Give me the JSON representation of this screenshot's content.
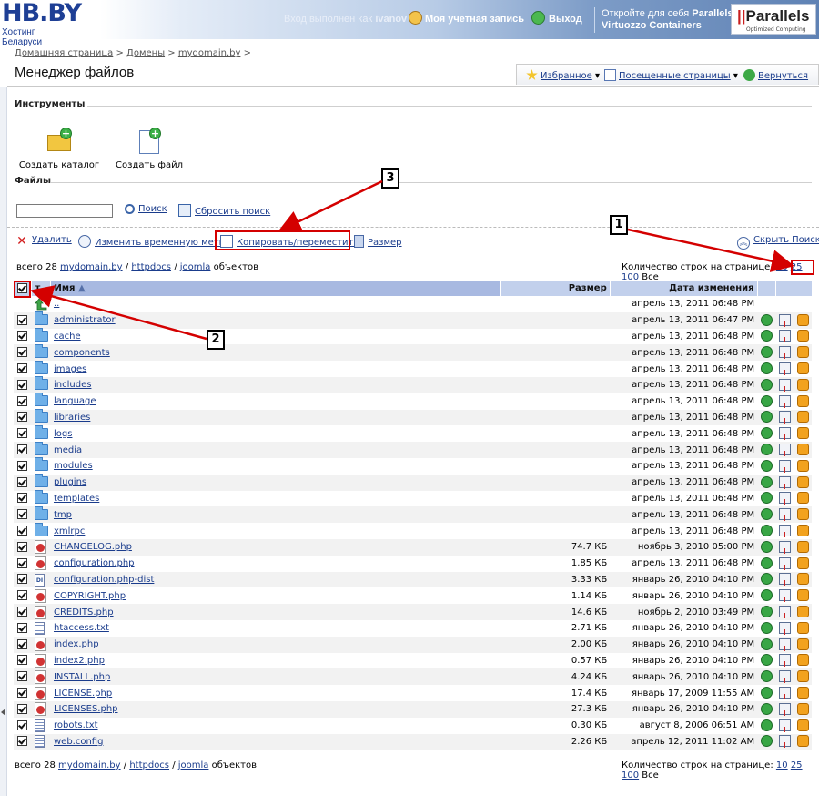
{
  "header": {
    "logo": "HB.BY",
    "logo_sub": "Хостинг Беларуси",
    "logged_in_as": "Вход выполнен как",
    "user": "ivanov",
    "account": "Моя учетная запись",
    "logout": "Выход",
    "promo_line1": "Откройте для себя",
    "promo_brand": "Parallels",
    "promo_line2": "Virtuozzo Containers",
    "parallels_logo": "Parallels",
    "parallels_sub": "Optimized Computing"
  },
  "breadcrumb": {
    "home": "Домашняя страница",
    "domains": "Домены",
    "domain": "mydomain.by"
  },
  "page": {
    "title": "Менеджер файлов"
  },
  "topnav": {
    "favorites": "Избранное",
    "visited": "Посещенные страницы",
    "back": "Вернуться"
  },
  "tools": {
    "section": "Инструменты",
    "create_dir": "Создать каталог",
    "create_file": "Создать файл"
  },
  "files": {
    "section": "Файлы",
    "search_value": "",
    "search": "Поиск",
    "reset_search": "Сбросить поиск",
    "delete": "Удалить",
    "timestamp": "Изменить временную метку",
    "copy_move": "Копировать/переместить",
    "size": "Размер",
    "hide_search": "Скрыть Поиск"
  },
  "summary": {
    "total_prefix": "всего 28",
    "path1": "mydomain.by",
    "path2": "httpdocs",
    "path3": "joomla",
    "total_suffix": "объектов",
    "rows_label": "Количество строк на странице:",
    "r10": "10",
    "r25": "25",
    "r100": "100",
    "rall": "Все"
  },
  "table": {
    "col_t": "т",
    "col_name": "Имя",
    "col_size": "Размер",
    "col_date": "Дата изменения"
  },
  "annotations": {
    "b1": "1",
    "b2": "2",
    "b3": "3"
  },
  "rows": [
    {
      "type": "up",
      "name": "..",
      "size": "",
      "date": "апрель 13, 2011 06:48 PM"
    },
    {
      "type": "dir",
      "name": "administrator",
      "size": "",
      "date": "апрель 13, 2011 06:47 PM"
    },
    {
      "type": "dir",
      "name": "cache",
      "size": "",
      "date": "апрель 13, 2011 06:48 PM"
    },
    {
      "type": "dir",
      "name": "components",
      "size": "",
      "date": "апрель 13, 2011 06:48 PM"
    },
    {
      "type": "dir",
      "name": "images",
      "size": "",
      "date": "апрель 13, 2011 06:48 PM"
    },
    {
      "type": "dir",
      "name": "includes",
      "size": "",
      "date": "апрель 13, 2011 06:48 PM"
    },
    {
      "type": "dir",
      "name": "language",
      "size": "",
      "date": "апрель 13, 2011 06:48 PM"
    },
    {
      "type": "dir",
      "name": "libraries",
      "size": "",
      "date": "апрель 13, 2011 06:48 PM"
    },
    {
      "type": "dir",
      "name": "logs",
      "size": "",
      "date": "апрель 13, 2011 06:48 PM"
    },
    {
      "type": "dir",
      "name": "media",
      "size": "",
      "date": "апрель 13, 2011 06:48 PM"
    },
    {
      "type": "dir",
      "name": "modules",
      "size": "",
      "date": "апрель 13, 2011 06:48 PM"
    },
    {
      "type": "dir",
      "name": "plugins",
      "size": "",
      "date": "апрель 13, 2011 06:48 PM"
    },
    {
      "type": "dir",
      "name": "templates",
      "size": "",
      "date": "апрель 13, 2011 06:48 PM"
    },
    {
      "type": "dir",
      "name": "tmp",
      "size": "",
      "date": "апрель 13, 2011 06:48 PM"
    },
    {
      "type": "dir",
      "name": "xmlrpc",
      "size": "",
      "date": "апрель 13, 2011 06:48 PM"
    },
    {
      "type": "php",
      "name": "CHANGELOG.php",
      "size": "74.7 КБ",
      "date": "ноябрь 3, 2010 05:00 PM"
    },
    {
      "type": "php",
      "name": "configuration.php",
      "size": "1.85 КБ",
      "date": "апрель 13, 2011 06:48 PM"
    },
    {
      "type": "dist",
      "name": "configuration.php-dist",
      "size": "3.33 КБ",
      "date": "январь 26, 2010 04:10 PM"
    },
    {
      "type": "php",
      "name": "COPYRIGHT.php",
      "size": "1.14 КБ",
      "date": "январь 26, 2010 04:10 PM"
    },
    {
      "type": "php",
      "name": "CREDITS.php",
      "size": "14.6 КБ",
      "date": "ноябрь 2, 2010 03:49 PM"
    },
    {
      "type": "txt",
      "name": "htaccess.txt",
      "size": "2.71 КБ",
      "date": "январь 26, 2010 04:10 PM"
    },
    {
      "type": "php",
      "name": "index.php",
      "size": "2.00 КБ",
      "date": "январь 26, 2010 04:10 PM"
    },
    {
      "type": "php",
      "name": "index2.php",
      "size": "0.57 КБ",
      "date": "январь 26, 2010 04:10 PM"
    },
    {
      "type": "php",
      "name": "INSTALL.php",
      "size": "4.24 КБ",
      "date": "январь 26, 2010 04:10 PM"
    },
    {
      "type": "php",
      "name": "LICENSE.php",
      "size": "17.4 КБ",
      "date": "январь 17, 2009 11:55 AM"
    },
    {
      "type": "php",
      "name": "LICENSES.php",
      "size": "27.3 КБ",
      "date": "январь 26, 2010 04:10 PM"
    },
    {
      "type": "txt",
      "name": "robots.txt",
      "size": "0.30 КБ",
      "date": "август 8, 2006 06:51 AM"
    },
    {
      "type": "txt",
      "name": "web.config",
      "size": "2.26 КБ",
      "date": "апрель 12, 2011 11:02 AM"
    }
  ]
}
